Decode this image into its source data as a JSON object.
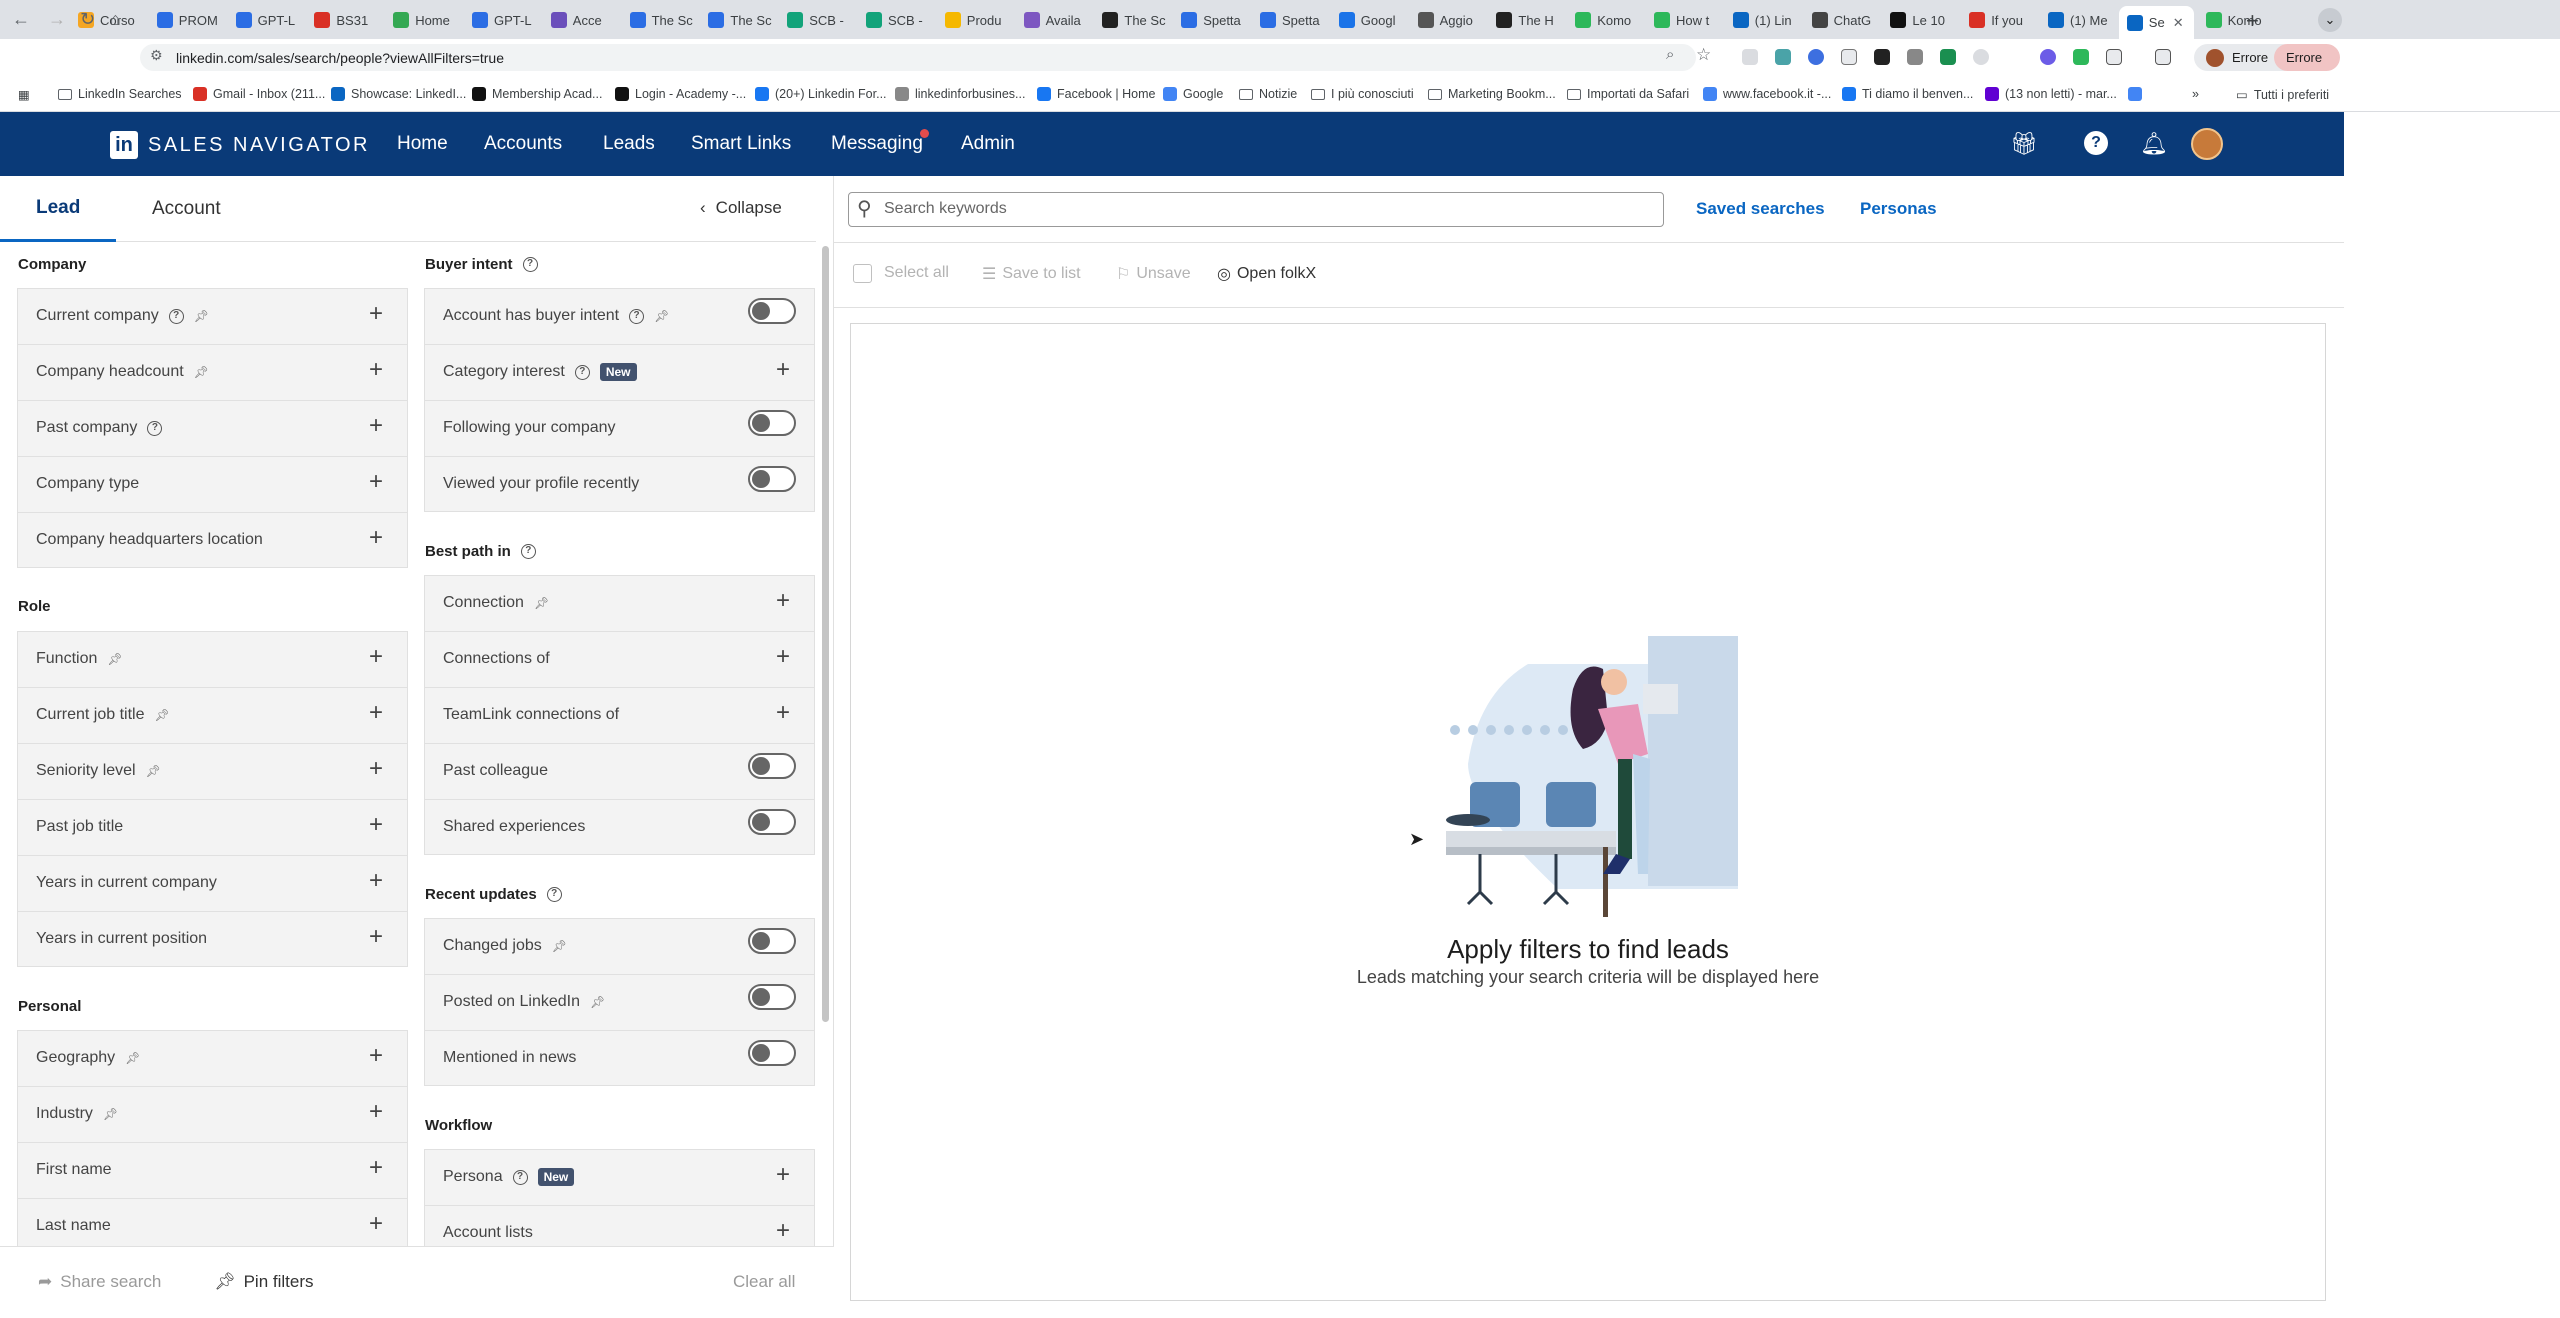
{
  "browser": {
    "tabs": [
      {
        "label": "Corso",
        "color": "#f5a623"
      },
      {
        "label": "PROM",
        "color": "#2b6de4"
      },
      {
        "label": "GPT-L",
        "color": "#2b6de4"
      },
      {
        "label": "BS31",
        "color": "#d93025"
      },
      {
        "label": "Home",
        "color": "#34a853"
      },
      {
        "label": "GPT-L",
        "color": "#2b6de4"
      },
      {
        "label": "Acce",
        "color": "#6b4fbb"
      },
      {
        "label": "The Sc",
        "color": "#2b6de4"
      },
      {
        "label": "The Sc",
        "color": "#2b6de4"
      },
      {
        "label": "SCB -",
        "color": "#12a37a"
      },
      {
        "label": "SCB -",
        "color": "#12a37a"
      },
      {
        "label": "Produ",
        "color": "#f5b800"
      },
      {
        "label": "Availa",
        "color": "#7d57c1"
      },
      {
        "label": "The Sc",
        "color": "#222"
      },
      {
        "label": "Spetta",
        "color": "#2b6de4"
      },
      {
        "label": "Spetta",
        "color": "#2b6de4"
      },
      {
        "label": "Googl",
        "color": "#1a73e8"
      },
      {
        "label": "Aggio",
        "color": "#555"
      },
      {
        "label": "The H",
        "color": "#222"
      },
      {
        "label": "Komo",
        "color": "#2db85a"
      },
      {
        "label": "How t",
        "color": "#2db85a"
      },
      {
        "label": "(1) Lin",
        "color": "#0a66c2"
      },
      {
        "label": "ChatG",
        "color": "#444"
      },
      {
        "label": "Le 10",
        "color": "#111"
      },
      {
        "label": "If you",
        "color": "#d93025"
      },
      {
        "label": "(1) Me",
        "color": "#0a66c2"
      },
      {
        "label": "Se",
        "color": "#0a66c2",
        "active": true
      },
      {
        "label": "Komo",
        "color": "#2db85a"
      }
    ],
    "new_tab": "+",
    "url": "linkedin.com/sales/search/people?viewAllFilters=true",
    "profile_button": "Errore",
    "bookmarks": [
      {
        "label": "LinkedIn Searches",
        "type": "folder"
      },
      {
        "label": "Gmail - Inbox (211...",
        "color": "#d93025"
      },
      {
        "label": "Showcase: LinkedI...",
        "color": "#0a66c2"
      },
      {
        "label": "Membership Acad...",
        "color": "#111"
      },
      {
        "label": "Login - Academy -...",
        "color": "#111"
      },
      {
        "label": "(20+) Linkedin For...",
        "color": "#1877f2"
      },
      {
        "label": "linkedinforbusines...",
        "color": "#888"
      },
      {
        "label": "Facebook | Home",
        "color": "#1877f2"
      },
      {
        "label": "Google",
        "color": "#4285f4"
      },
      {
        "label": "Notizie",
        "type": "folder"
      },
      {
        "label": "I più conosciuti",
        "type": "folder"
      },
      {
        "label": "Marketing Bookm...",
        "type": "folder"
      },
      {
        "label": "Importati da Safari",
        "type": "folder"
      },
      {
        "label": "www.facebook.it -...",
        "color": "#4285f4"
      },
      {
        "label": "Ti diamo il benven...",
        "color": "#1877f2"
      },
      {
        "label": "(13 non letti) - mar...",
        "color": "#6001d2"
      },
      {
        "label": "",
        "color": "#4285f4"
      }
    ],
    "bookmarks_more": "»",
    "other_bookmarks": "Tutti i preferiti"
  },
  "header": {
    "logo": "in",
    "brand": "SALES NAVIGATOR",
    "nav": [
      "Home",
      "Accounts",
      "Leads",
      "Smart Links",
      "Messaging",
      "Admin"
    ]
  },
  "left": {
    "tabs": {
      "lead": "Lead",
      "account": "Account"
    },
    "collapse": "Collapse",
    "sections": {
      "company": "Company",
      "role": "Role",
      "personal": "Personal",
      "buyer_intent": "Buyer intent",
      "best_path": "Best path in",
      "recent_updates": "Recent updates",
      "workflow": "Workflow"
    },
    "company_filters": [
      "Current company",
      "Company headcount",
      "Past company",
      "Company type",
      "Company headquarters location"
    ],
    "role_filters": [
      "Function",
      "Current job title",
      "Seniority level",
      "Past job title",
      "Years in current company",
      "Years in current position"
    ],
    "personal_filters": [
      "Geography",
      "Industry",
      "First name",
      "Last name"
    ],
    "buyer_intent_filters": [
      "Account has buyer intent",
      "Category interest",
      "Following your company",
      "Viewed your profile recently"
    ],
    "best_path_filters": [
      "Connection",
      "Connections of",
      "TeamLink connections of",
      "Past colleague",
      "Shared experiences"
    ],
    "recent_updates_filters": [
      "Changed jobs",
      "Posted on LinkedIn",
      "Mentioned in news"
    ],
    "workflow_filters": [
      "Persona",
      "Account lists"
    ],
    "new_badge": "New",
    "footer": {
      "share": "Share search",
      "pin": "Pin filters",
      "clear": "Clear all"
    }
  },
  "right": {
    "search_placeholder": "Search keywords",
    "saved_searches": "Saved searches",
    "personas": "Personas",
    "toolbar": {
      "select_all": "Select all",
      "save_to_list": "Save to list",
      "unsave": "Unsave",
      "open_folkx": "Open folkX"
    },
    "empty_title": "Apply filters to find leads",
    "empty_subtitle": "Leads matching your search criteria will be displayed here"
  }
}
